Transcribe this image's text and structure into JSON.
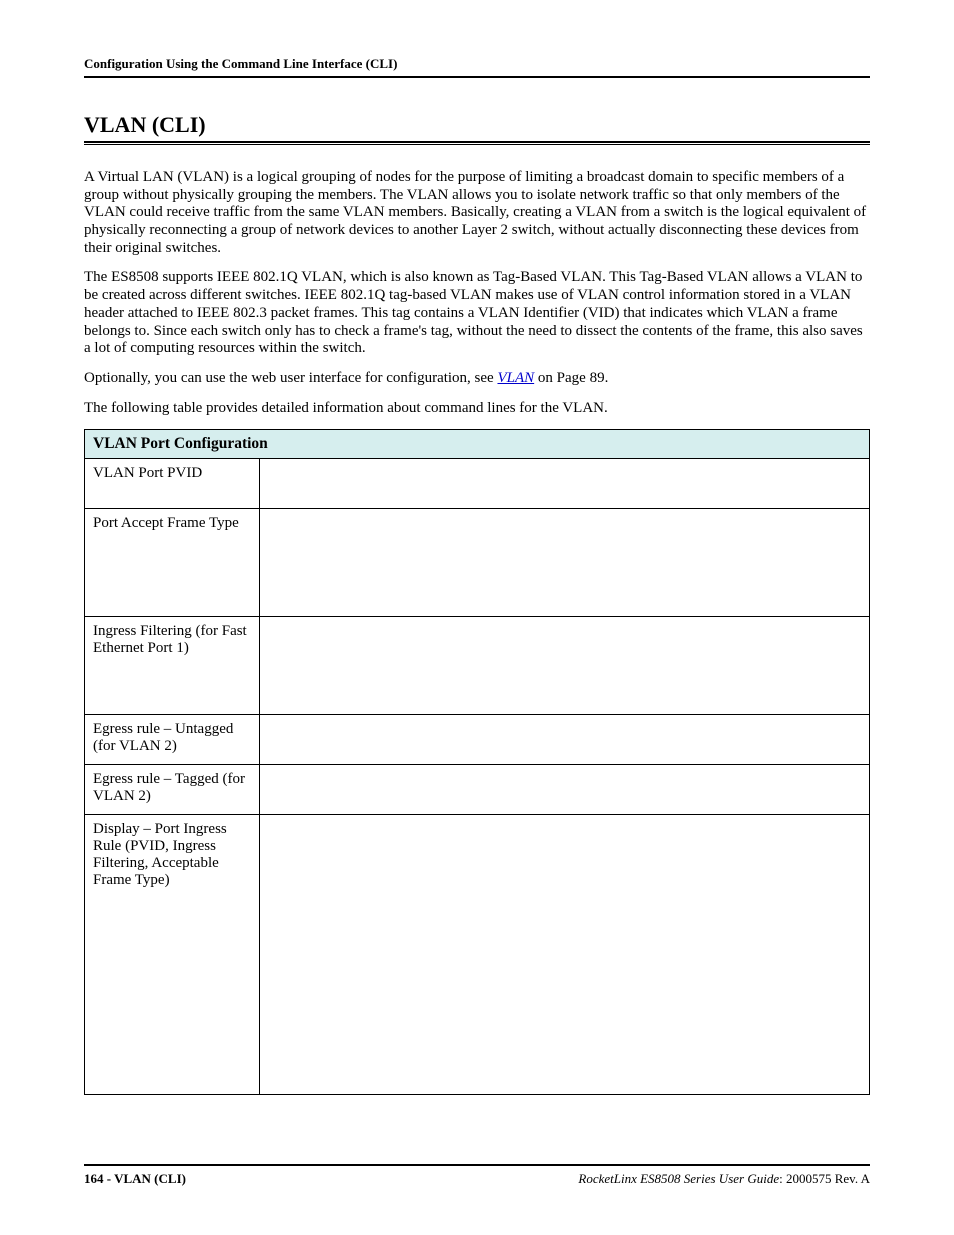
{
  "header": {
    "running": "Configuration Using the Command Line Interface (CLI)"
  },
  "section": {
    "title": "VLAN (CLI)"
  },
  "paragraphs": {
    "p1": "A Virtual LAN (VLAN) is a logical grouping of nodes for the purpose of limiting a broadcast domain to specific members of a group without physically grouping the members. The VLAN allows you to isolate network traffic so that only members of the VLAN could receive traffic from the same VLAN members. Basically, creating a VLAN from a switch is the logical equivalent of physically reconnecting a group of network devices to another Layer 2 switch, without actually disconnecting these devices from their original switches.",
    "p2": "The ES8508 supports IEEE 802.1Q VLAN, which is also known as Tag-Based VLAN. This Tag-Based VLAN allows a VLAN to be created across different switches. IEEE 802.1Q tag-based VLAN makes use of VLAN control information stored in a VLAN header attached to IEEE 802.3 packet frames. This tag contains a VLAN Identifier (VID) that indicates which VLAN a frame belongs to. Since each switch only has to check a frame's tag, without the need to dissect the contents of the frame, this also saves a lot of computing resources within the switch.",
    "p3_pre": "Optionally, you can use the web user interface for configuration, see ",
    "p3_link": "VLAN",
    "p3_post": " on Page 89.",
    "p4": "The following table provides detailed information about command lines for the VLAN."
  },
  "table": {
    "header": "VLAN Port Configuration",
    "rows": {
      "pvid": "VLAN Port PVID",
      "accept": "Port Accept Frame Type",
      "ingress": "Ingress Filtering (for Fast Ethernet Port 1)",
      "egress_u": "Egress rule – Untagged (for VLAN 2)",
      "egress_t": "Egress rule – Tagged (for VLAN 2)",
      "display": "Display – Port Ingress Rule (PVID, Ingress Filtering, Acceptable Frame Type)"
    }
  },
  "footer": {
    "left": "164 - VLAN (CLI)",
    "guide_title": "RocketLinx ES8508 Series  User Guide",
    "right_tail": ": 2000575 Rev. A"
  },
  "xref": {
    "vlan_page": 89
  }
}
